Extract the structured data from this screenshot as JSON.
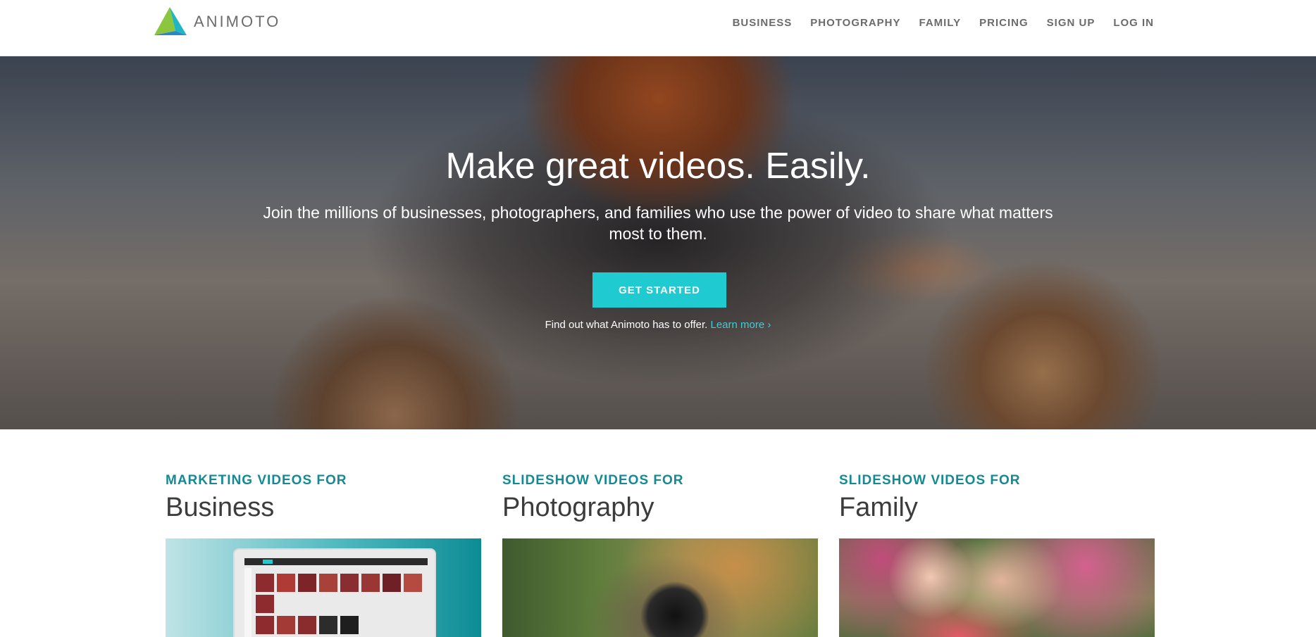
{
  "brand": {
    "name": "ANIMOTO"
  },
  "nav": {
    "items": [
      "BUSINESS",
      "PHOTOGRAPHY",
      "FAMILY",
      "PRICING",
      "SIGN UP",
      "LOG IN"
    ]
  },
  "hero": {
    "title": "Make great videos. Easily.",
    "subtitle": "Join the millions of businesses, photographers, and families who use the power of video to share what matters most to them.",
    "cta_label": "GET STARTED",
    "learn_text": "Find out what Animoto has to offer.",
    "learn_link": "Learn more ›"
  },
  "cards": [
    {
      "kicker": "MARKETING VIDEOS FOR",
      "title": "Business"
    },
    {
      "kicker": "SLIDESHOW VIDEOS FOR",
      "title": "Photography"
    },
    {
      "kicker": "SLIDESHOW VIDEOS FOR",
      "title": "Family"
    }
  ],
  "colors": {
    "accent": "#1fcbd1",
    "kicker": "#138a94",
    "nav_text": "#6b6b6b"
  }
}
